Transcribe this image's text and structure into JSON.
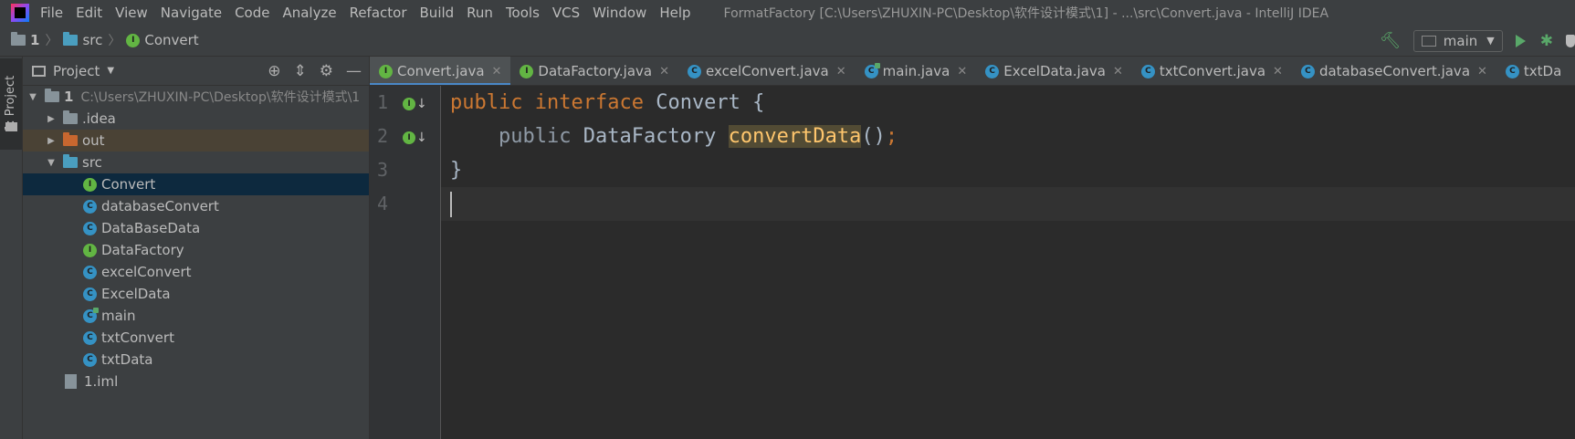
{
  "menubar": {
    "items": [
      "File",
      "Edit",
      "View",
      "Navigate",
      "Code",
      "Analyze",
      "Refactor",
      "Build",
      "Run",
      "Tools",
      "VCS",
      "Window",
      "Help"
    ],
    "window_title": "FormatFactory [C:\\Users\\ZHUXIN-PC\\Desktop\\软件设计模式\\1] - ...\\src\\Convert.java - IntelliJ IDEA"
  },
  "navbar": {
    "crumbs": [
      "1",
      "src",
      "Convert"
    ],
    "run_config": "main"
  },
  "toolstrip": {
    "label": "1: Project"
  },
  "project_panel": {
    "title": "Project",
    "tree": [
      {
        "label": "1",
        "path": "C:\\Users\\ZHUXIN-PC\\Desktop\\软件设计模式\\1"
      },
      {
        "label": ".idea"
      },
      {
        "label": "out"
      },
      {
        "label": "src"
      },
      {
        "label": "Convert"
      },
      {
        "label": "databaseConvert"
      },
      {
        "label": "DataBaseData"
      },
      {
        "label": "DataFactory"
      },
      {
        "label": "excelConvert"
      },
      {
        "label": "ExcelData"
      },
      {
        "label": "main"
      },
      {
        "label": "txtConvert"
      },
      {
        "label": "txtData"
      },
      {
        "label": "1.iml"
      }
    ]
  },
  "tabs": [
    {
      "label": "Convert.java"
    },
    {
      "label": "DataFactory.java"
    },
    {
      "label": "excelConvert.java"
    },
    {
      "label": "main.java"
    },
    {
      "label": "ExcelData.java"
    },
    {
      "label": "txtConvert.java"
    },
    {
      "label": "databaseConvert.java"
    },
    {
      "label": "txtDa"
    }
  ],
  "editor": {
    "line_numbers": [
      "1",
      "2",
      "3",
      "4"
    ],
    "code": {
      "l1_kw1": "public",
      "l1_kw2": "interface",
      "l1_name": "Convert",
      "l1_brace": "{",
      "l2_kw": "public",
      "l2_type": "DataFactory",
      "l2_method": "convertData",
      "l2_parens": "()",
      "l2_semi": ";",
      "l3": "}"
    }
  },
  "colors": {
    "keyword": "#cc7832",
    "method": "#ffc66d",
    "identifier": "#a9b7c6",
    "selection": "#0d293e",
    "active_tab_underline": "#4a88c7"
  },
  "icons": [
    "app-logo-icon",
    "folder-icon",
    "class-icon",
    "interface-icon",
    "hammer-icon",
    "run-icon",
    "debug-icon",
    "shield-icon",
    "crosshair-icon",
    "collapse-icon",
    "gear-icon",
    "minimize-icon"
  ]
}
